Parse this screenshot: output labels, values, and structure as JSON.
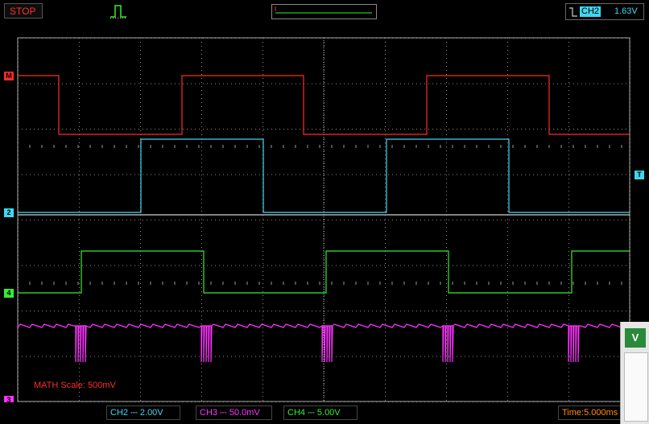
{
  "status": {
    "run_state": "STOP"
  },
  "trigger": {
    "channel": "CH2",
    "level": "1.63V"
  },
  "markers": {
    "math": "M",
    "ch2": "2",
    "ch4": "4",
    "ch3": "3",
    "trigger": "T"
  },
  "math_label": "MATH Scale:  500mV",
  "bottom": {
    "ch2": "CH2 ⎓  2.00V",
    "ch3": "CH3 ⎓  50.0mV",
    "ch4": "CH4 ⎓   5.00V",
    "time": "Time:5.000ms"
  },
  "colors": {
    "math": "#ff2a2a",
    "ch2": "#3fd7f0",
    "ch3": "#ff33ff",
    "ch4": "#33ee33",
    "grid": "#a0a0a0"
  },
  "widget": {
    "icon": "app-logo-icon"
  }
}
